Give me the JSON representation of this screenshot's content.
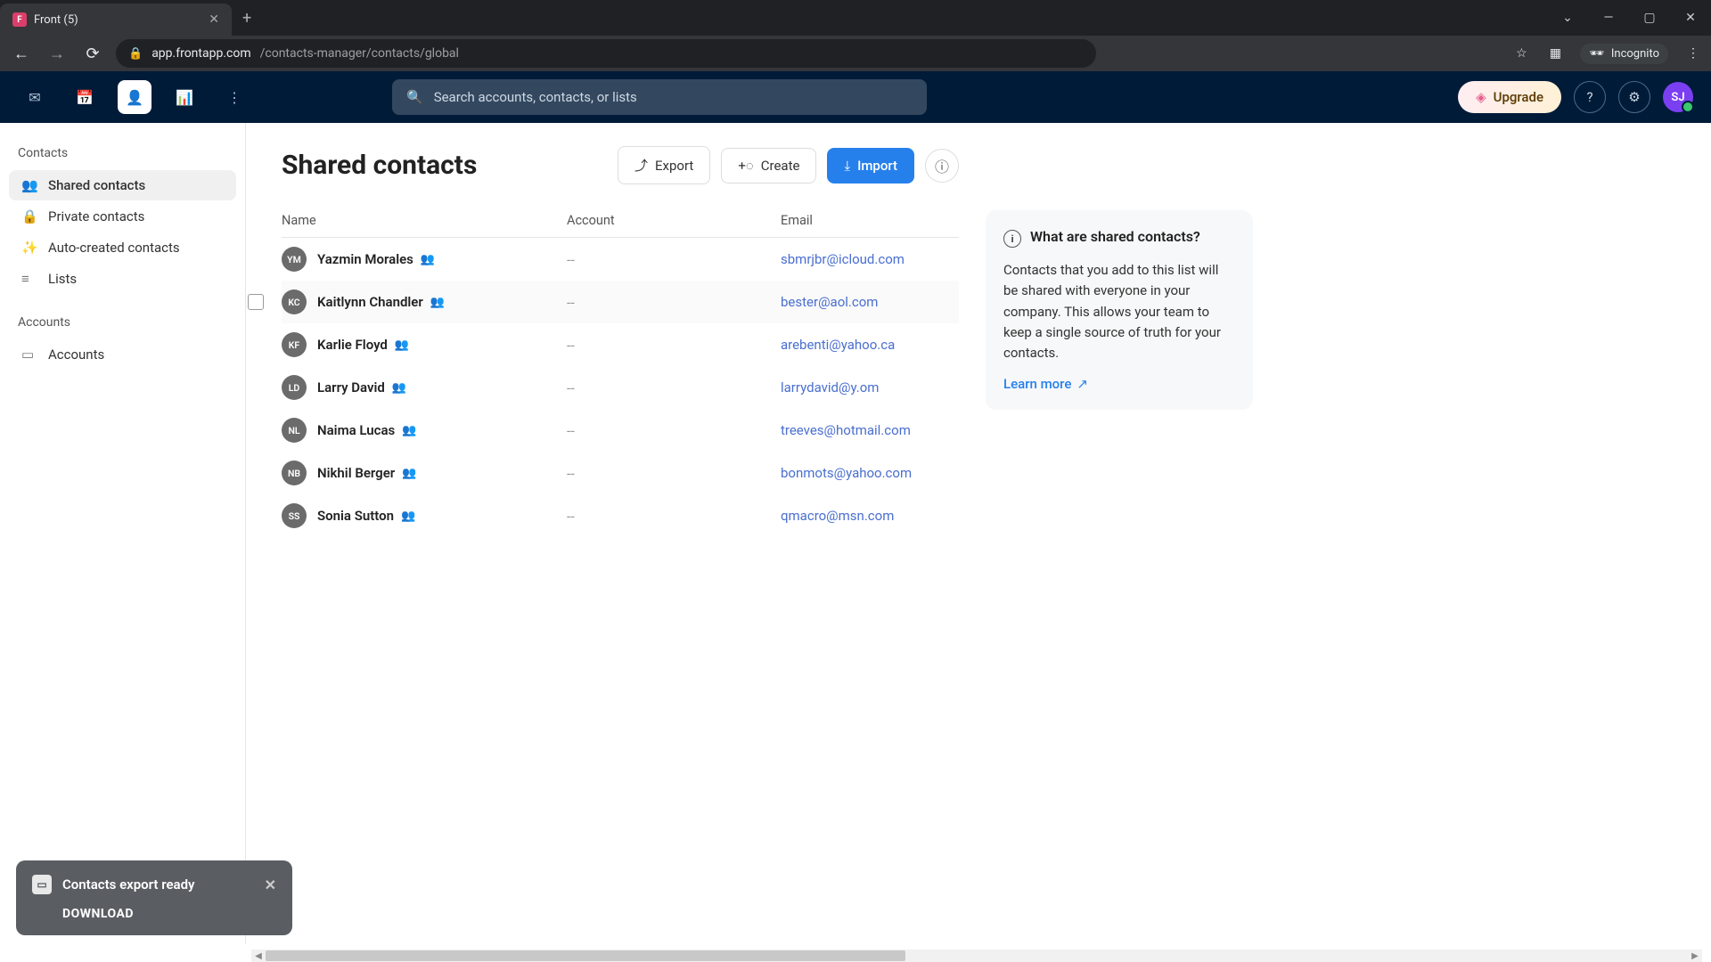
{
  "browser": {
    "tab_title": "Front (5)",
    "url_host": "app.frontapp.com",
    "url_path": "/contacts-manager/contacts/global",
    "incognito_label": "Incognito"
  },
  "header": {
    "search_placeholder": "Search accounts, contacts, or lists",
    "upgrade_label": "Upgrade",
    "avatar_initials": "SJ"
  },
  "sidebar": {
    "section1_label": "Contacts",
    "items1": [
      {
        "label": "Shared contacts",
        "active": true
      },
      {
        "label": "Private contacts",
        "active": false
      },
      {
        "label": "Auto-created contacts",
        "active": false
      },
      {
        "label": "Lists",
        "active": false
      }
    ],
    "section2_label": "Accounts",
    "items2": [
      {
        "label": "Accounts"
      }
    ]
  },
  "page": {
    "title": "Shared contacts",
    "export_label": "Export",
    "create_label": "Create",
    "import_label": "Import"
  },
  "columns": {
    "name": "Name",
    "account": "Account",
    "email": "Email"
  },
  "contacts": [
    {
      "initials": "YM",
      "name": "Yazmin Morales",
      "account": "--",
      "email": "sbmrjbr@icloud.com",
      "hovered": false
    },
    {
      "initials": "KC",
      "name": "Kaitlynn Chandler",
      "account": "--",
      "email": "bester@aol.com",
      "hovered": true
    },
    {
      "initials": "KF",
      "name": "Karlie Floyd",
      "account": "--",
      "email": "arebenti@yahoo.ca",
      "hovered": false
    },
    {
      "initials": "LD",
      "name": "Larry David",
      "account": "--",
      "email": "larrydavid@y.om",
      "hovered": false
    },
    {
      "initials": "NL",
      "name": "Naima Lucas",
      "account": "--",
      "email": "treeves@hotmail.com",
      "hovered": false
    },
    {
      "initials": "NB",
      "name": "Nikhil Berger",
      "account": "--",
      "email": "bonmots@yahoo.com",
      "hovered": false
    },
    {
      "initials": "SS",
      "name": "Sonia Sutton",
      "account": "--",
      "email": "qmacro@msn.com",
      "hovered": false
    }
  ],
  "info_panel": {
    "title": "What are shared contacts?",
    "body": "Contacts that you add to this list will be shared with everyone in your company. This allows your team to keep a single source of truth for your contacts.",
    "learn_more": "Learn more"
  },
  "toast": {
    "title": "Contacts export ready",
    "action": "DOWNLOAD"
  }
}
